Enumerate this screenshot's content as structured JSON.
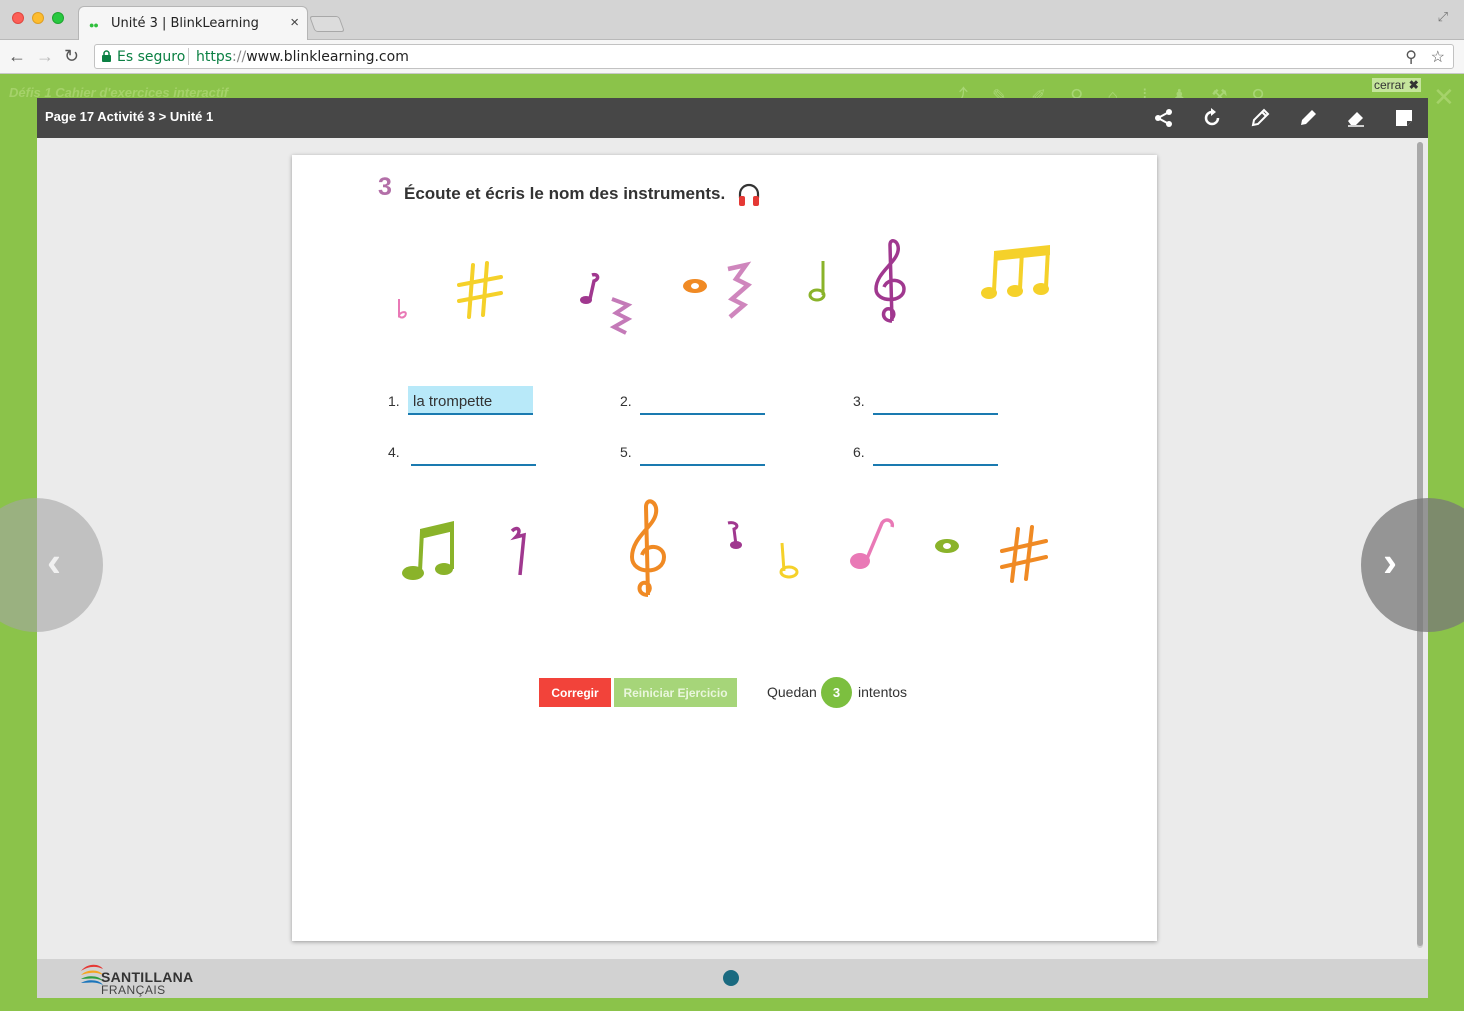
{
  "browser": {
    "tab_title": "Unité 3 | BlinkLearning",
    "tab_close": "×",
    "secure_label": "Es seguro",
    "url_scheme": "https",
    "url_sep": "://",
    "url_host": "www.blinklearning.com"
  },
  "app": {
    "title": "Défis 1 Cahier d'exercices interactif",
    "close_label": "cerrar",
    "close_glyph": "✖"
  },
  "modal": {
    "breadcrumb": "Page 17 Activité 3 > Unité 1",
    "tools": [
      "share-icon",
      "refresh-icon",
      "pencil-outline-icon",
      "pen-icon",
      "eraser-icon",
      "note-icon"
    ]
  },
  "activity": {
    "number": "3",
    "title": "Écoute et écris le nom des instruments.",
    "answers": [
      {
        "num": "1.",
        "value": "la trompette"
      },
      {
        "num": "2.",
        "value": ""
      },
      {
        "num": "3.",
        "value": ""
      },
      {
        "num": "4.",
        "value": ""
      },
      {
        "num": "5.",
        "value": ""
      },
      {
        "num": "6.",
        "value": ""
      }
    ]
  },
  "actions": {
    "check_label": "Corregir",
    "reset_label": "Reiniciar Ejercicio",
    "remaining_prefix": "Quedan",
    "remaining_count": "3",
    "remaining_suffix": "intentos"
  },
  "footer": {
    "brand": "SANTILLANA",
    "brand_sub": "FRANÇAIS"
  },
  "nav": {
    "prev": "‹",
    "next": "›"
  },
  "colors": {
    "app_green": "#8bc34a",
    "header_dark": "#474747",
    "check_red": "#f2433a",
    "reset_green": "#a6d579",
    "field_fill": "#b8e9f9",
    "field_line": "#1a7ab0",
    "activity_purple": "#b36fa8"
  }
}
